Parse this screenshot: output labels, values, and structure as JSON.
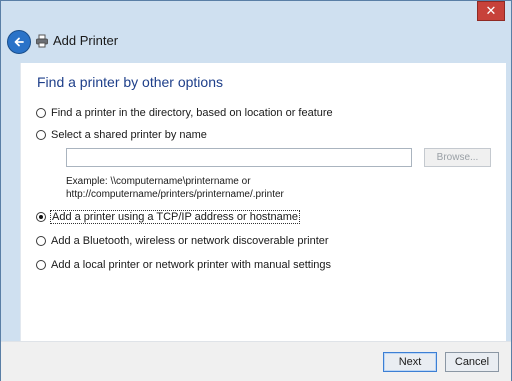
{
  "window": {
    "title": "Add Printer",
    "close_glyph": "✕"
  },
  "heading": "Find a printer by other options",
  "options": [
    {
      "label": "Find a printer in the directory, based on location or feature",
      "selected": false
    },
    {
      "label": "Select a shared printer by name",
      "selected": false
    },
    {
      "label": "Add a printer using a TCP/IP address or hostname",
      "selected": true
    },
    {
      "label": "Add a Bluetooth, wireless or network discoverable printer",
      "selected": false
    },
    {
      "label": "Add a local printer or network printer with manual settings",
      "selected": false
    }
  ],
  "shared_printer": {
    "value": "",
    "browse_label": "Browse...",
    "example_line1": "Example: \\\\computername\\printername or",
    "example_line2": "http://computername/printers/printername/.printer"
  },
  "footer": {
    "next_label": "Next",
    "cancel_label": "Cancel"
  },
  "colors": {
    "accent": "#2a73c8",
    "heading": "#1e3f8a",
    "close": "#c7423a"
  },
  "icons": {
    "back": "back-arrow-icon",
    "printer": "printer-icon",
    "close": "close-icon"
  }
}
